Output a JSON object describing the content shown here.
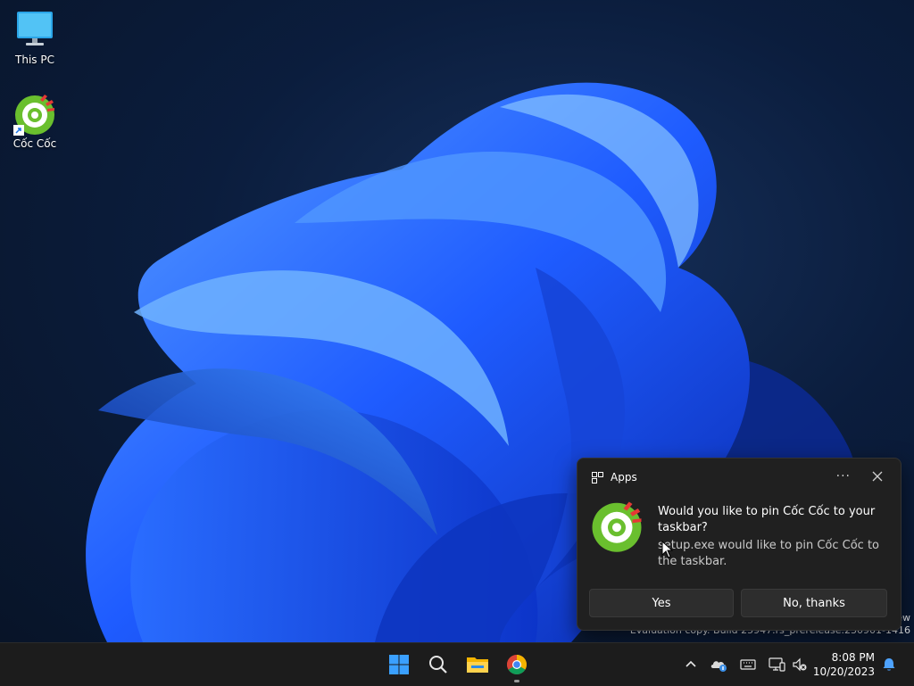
{
  "desktop": {
    "icons": [
      {
        "label": "This PC",
        "icon": "monitor-icon"
      },
      {
        "label": "Cốc Cốc",
        "icon": "coccoc-icon"
      }
    ],
    "watermark": {
      "line1": "ew",
      "line2": "Evaluation copy. Build 25947.rs_prerelease.230901-1416"
    }
  },
  "notification": {
    "header": "Apps",
    "header_icon": "apps-icon",
    "more_label": "···",
    "title": "Would you like to pin Cốc Cốc to your taskbar?",
    "body": "setup.exe would like to pin Cốc Cốc to the taskbar.",
    "buttons": {
      "yes": "Yes",
      "no": "No, thanks"
    },
    "app_icon": "coccoc-icon"
  },
  "taskbar": {
    "apps": [
      "start-icon",
      "search-icon",
      "file-explorer-icon",
      "chrome-icon"
    ],
    "tray_icons": [
      "chevron-up-icon",
      "onedrive-icon",
      "keyboard-icon",
      "display-icon",
      "volume-muted-icon",
      "notification-bell-icon"
    ],
    "time": "8:08 PM",
    "date": "10/20/2023"
  },
  "colors": {
    "accent": "#0078d4",
    "coccoc_green": "#6abf2e",
    "coccoc_red": "#e53935",
    "toast_bg": "#202020",
    "taskbar_bg": "#1c1c1c"
  }
}
